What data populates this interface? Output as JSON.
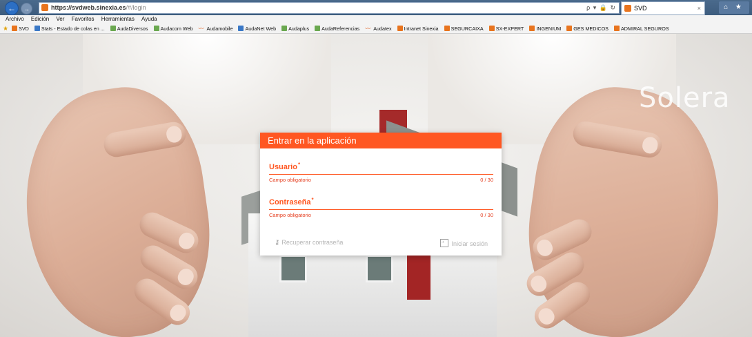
{
  "browser": {
    "url_host": "https://svdweb.sinexia.es",
    "url_path": "/#/login",
    "url_tools": "ρ ▾ 🔒 ↻",
    "tab_title": "SVD",
    "tab_close": "×",
    "window_controls": "⌂ ★"
  },
  "menu": [
    "Archivo",
    "Edición",
    "Ver",
    "Favoritos",
    "Herramientas",
    "Ayuda"
  ],
  "favorites": [
    {
      "label": "SVD",
      "icon": "orange"
    },
    {
      "label": "Stats - Estado de colas en ...",
      "icon": "blue"
    },
    {
      "label": "AudaDiversos",
      "icon": "green"
    },
    {
      "label": "Audacom Web",
      "icon": "green"
    },
    {
      "label": "Audamobile",
      "icon": "swirl"
    },
    {
      "label": "AudaNet Web",
      "icon": "blue"
    },
    {
      "label": "Audaplus",
      "icon": "green"
    },
    {
      "label": "AudaReferencias",
      "icon": "green"
    },
    {
      "label": "Audatex",
      "icon": "swirl"
    },
    {
      "label": "Intranet Sinexia",
      "icon": "orange"
    },
    {
      "label": "SEGURCAIXA",
      "icon": "orange"
    },
    {
      "label": "SX-EXPERT",
      "icon": "orange"
    },
    {
      "label": "INGENIUM",
      "icon": "orange"
    },
    {
      "label": "GES MEDICOS",
      "icon": "orange"
    },
    {
      "label": "ADMIRAL SEGUROS",
      "icon": "orange"
    }
  ],
  "brand": "Solera",
  "login": {
    "title": "Entrar en la aplicación",
    "user_label": "Usuario",
    "password_label": "Contraseña",
    "required_mark": "*",
    "required_hint": "Campo obligatorio",
    "user_counter": "0 / 30",
    "password_counter": "0 / 30",
    "recover_label": "Recuperar contraseña",
    "login_label": "Iniciar sesión"
  },
  "colors": {
    "accent": "#ff5722",
    "error": "#e53e1f",
    "disabled": "#b4b4b4"
  }
}
